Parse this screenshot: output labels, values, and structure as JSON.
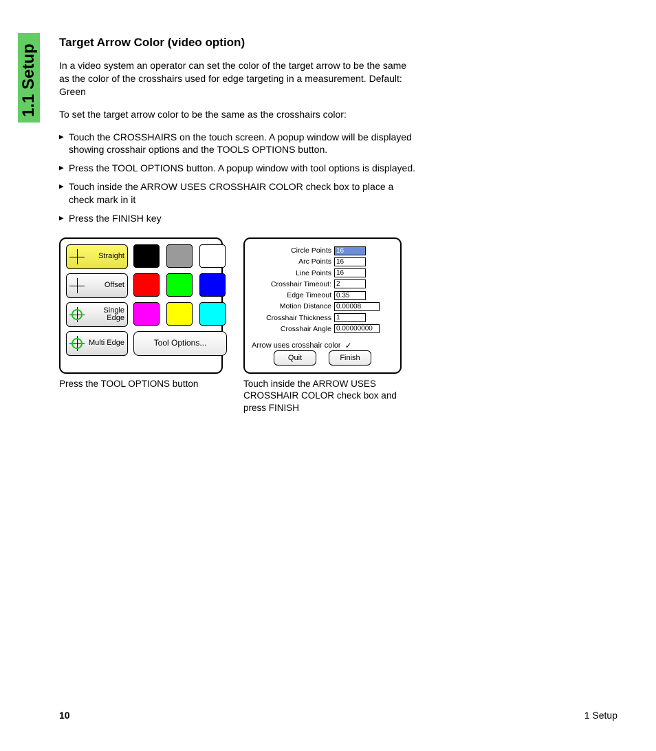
{
  "side": {
    "label": "1.1 Setup"
  },
  "heading": "Target Arrow Color (video option)",
  "para1": "In a video system an operator can set the color of the target arrow to be the same as the color of the crosshairs used for edge targeting in a measurement. Default: Green",
  "para2": "To set the target arrow color to be the same as the crosshairs color:",
  "steps": [
    "Touch the CROSSHAIRS on the touch screen. A popup window will be displayed showing crosshair options and the TOOLS OPTIONS button.",
    "Press the TOOL OPTIONS button. A popup window with tool options is displayed.",
    "Touch inside the ARROW USES CROSSHAIR COLOR check box to place a check mark in it",
    "Press the FINISH key"
  ],
  "palette": {
    "modes": {
      "straight": "Straight",
      "offset": "Offset",
      "single": "Single Edge",
      "multi": "Multi Edge"
    },
    "tool_options": "Tool Options...",
    "swatches": [
      [
        "#000000",
        "#9a9a9a",
        "#ffffff"
      ],
      [
        "#ff0000",
        "#00ff00",
        "#0000ff"
      ],
      [
        "#ff00ff",
        "#ffff00",
        "#00ffff"
      ]
    ]
  },
  "caption1": "Press the TOOL OPTIONS button",
  "dialog": {
    "fields": {
      "circle_points": {
        "label": "Circle Points",
        "value": "16"
      },
      "arc_points": {
        "label": "Arc Points",
        "value": "16"
      },
      "line_points": {
        "label": "Line Points",
        "value": "16"
      },
      "crosshair_timeout": {
        "label": "Crosshair Timeout:",
        "value": "2"
      },
      "edge_timeout": {
        "label": "Edge Timeout",
        "value": "0.35"
      },
      "motion_distance": {
        "label": "Motion Distance",
        "value": "0.00008"
      },
      "crosshair_thickness": {
        "label": "Crosshair Thickness",
        "value": "1"
      },
      "crosshair_angle": {
        "label": "Crosshair Angle",
        "value": "0.00000000"
      }
    },
    "checkbox_label": "Arrow uses crosshair color",
    "checkbox_mark": "✓",
    "quit": "Quit",
    "finish": "Finish"
  },
  "caption2": "Touch inside the ARROW USES CROSSHAIR COLOR check box and press FINISH",
  "footer": {
    "page": "10",
    "section": "1 Setup"
  }
}
